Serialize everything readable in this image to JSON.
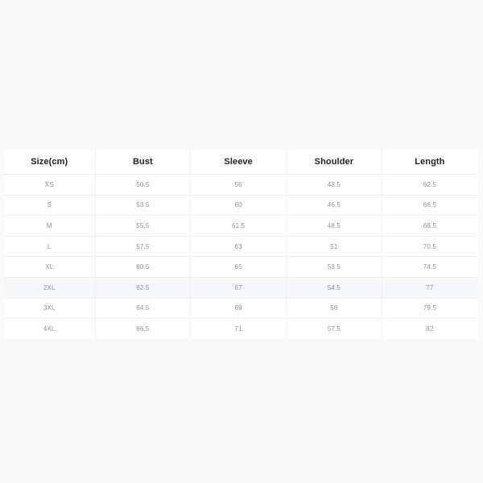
{
  "chart_data": {
    "type": "table",
    "title": "",
    "columns": [
      "Size(cm)",
      "Bust",
      "Sleeve",
      "Shoulder",
      "Length"
    ],
    "rows": [
      {
        "size": "XS",
        "bust": "50.5",
        "sleeve": "56",
        "shoulder": "43.5",
        "length": "62.5",
        "highlighted": false
      },
      {
        "size": "S",
        "bust": "53.5",
        "sleeve": "60",
        "shoulder": "46.5",
        "length": "66.5",
        "highlighted": false
      },
      {
        "size": "M",
        "bust": "55.5",
        "sleeve": "61.5",
        "shoulder": "48.5",
        "length": "68.5",
        "highlighted": false
      },
      {
        "size": "L",
        "bust": "57.5",
        "sleeve": "63",
        "shoulder": "51",
        "length": "70.5",
        "highlighted": false
      },
      {
        "size": "XL",
        "bust": "60.5",
        "sleeve": "65",
        "shoulder": "53.5",
        "length": "74.5",
        "highlighted": false
      },
      {
        "size": "2XL",
        "bust": "62.5",
        "sleeve": "67",
        "shoulder": "54.5",
        "length": "77",
        "highlighted": true
      },
      {
        "size": "3XL",
        "bust": "64.5",
        "sleeve": "69",
        "shoulder": "56",
        "length": "79.5",
        "highlighted": false
      },
      {
        "size": "4XL",
        "bust": "66.5",
        "sleeve": "71",
        "shoulder": "57.5",
        "length": "82",
        "highlighted": false
      }
    ],
    "colors": {
      "page_background": "#f9f9fa",
      "table_background": "#ffffff",
      "header_text": "#222222",
      "cell_text": "#8a8f9e",
      "row_border": "#eeeeef",
      "column_border": "#f0f0f1",
      "highlight_row": "#f5f6fa"
    }
  }
}
